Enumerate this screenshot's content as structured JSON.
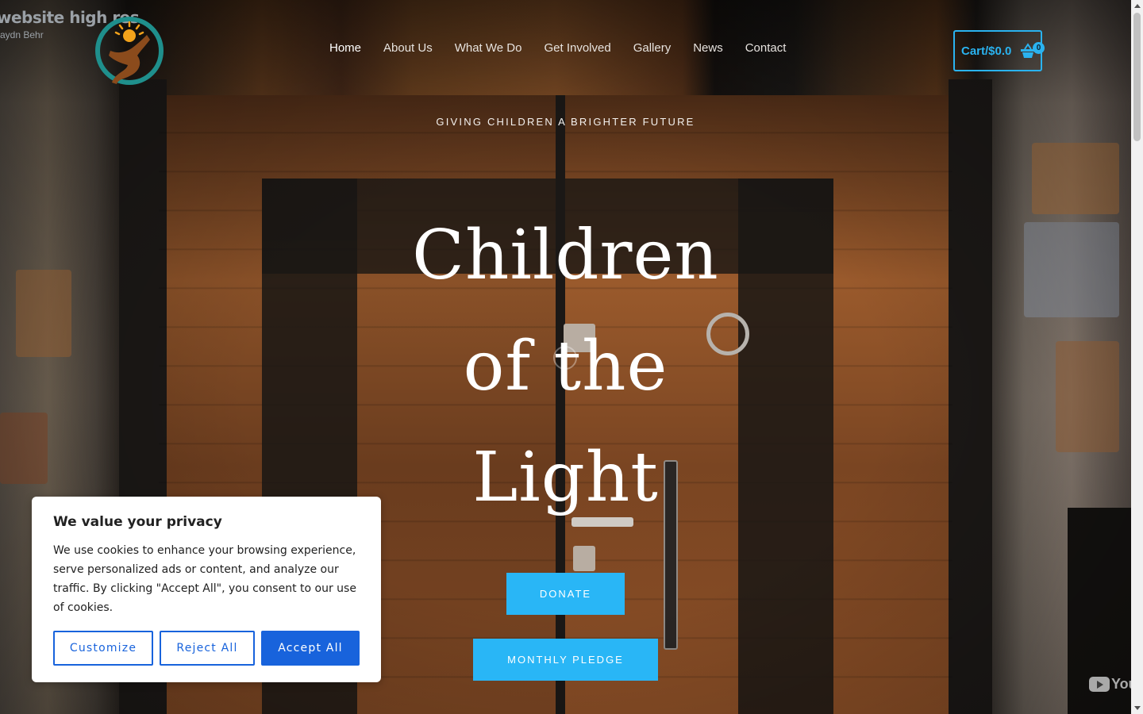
{
  "window": {
    "video_title": "website high res",
    "video_channel": "aydn Behr",
    "video_brand": "You"
  },
  "header": {
    "logo_icon": "children-of-the-light-logo-icon",
    "nav": [
      {
        "label": "Home",
        "active": true
      },
      {
        "label": "About Us"
      },
      {
        "label": "What We Do"
      },
      {
        "label": "Get Involved"
      },
      {
        "label": "Gallery"
      },
      {
        "label": "News"
      },
      {
        "label": "Contact"
      }
    ],
    "cart": {
      "label": "Cart/$0.0",
      "count": "0",
      "icon": "basket-icon"
    }
  },
  "hero": {
    "tagline": "GIVING CHILDREN A BRIGHTER FUTURE",
    "title_lines": [
      "Children",
      "of the",
      "Light"
    ],
    "donate_label": "DONATE",
    "pledge_label": "MONTHLY PLEDGE"
  },
  "cookie": {
    "title": "We value your privacy",
    "text": "We use cookies to enhance your browsing experience, serve personalized ads or content, and analyze our traffic. By clicking \"Accept All\", you consent to our use of cookies.",
    "customize_label": "Customize",
    "reject_label": "Reject All",
    "accept_label": "Accept All"
  },
  "colors": {
    "accent": "#29b6f6",
    "cookie_blue": "#1863dc"
  }
}
